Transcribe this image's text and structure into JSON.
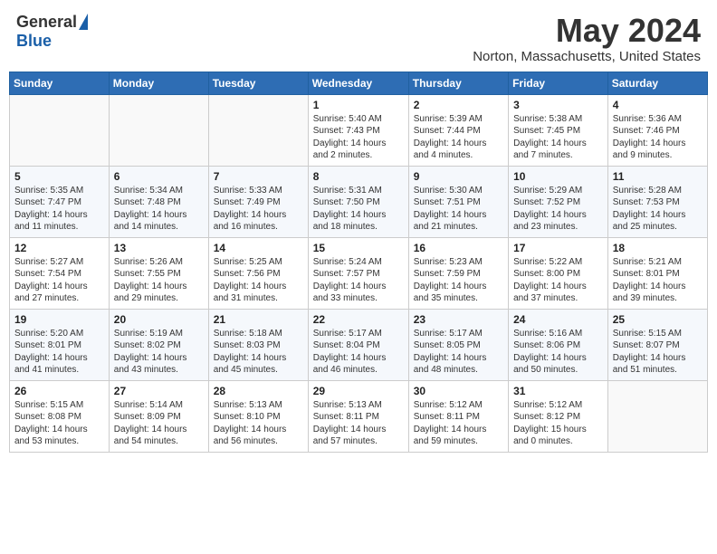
{
  "header": {
    "logo_general": "General",
    "logo_blue": "Blue",
    "month_year": "May 2024",
    "location": "Norton, Massachusetts, United States"
  },
  "calendar": {
    "days_of_week": [
      "Sunday",
      "Monday",
      "Tuesday",
      "Wednesday",
      "Thursday",
      "Friday",
      "Saturday"
    ],
    "weeks": [
      [
        {
          "day": "",
          "content": ""
        },
        {
          "day": "",
          "content": ""
        },
        {
          "day": "",
          "content": ""
        },
        {
          "day": "1",
          "content": "Sunrise: 5:40 AM\nSunset: 7:43 PM\nDaylight: 14 hours\nand 2 minutes."
        },
        {
          "day": "2",
          "content": "Sunrise: 5:39 AM\nSunset: 7:44 PM\nDaylight: 14 hours\nand 4 minutes."
        },
        {
          "day": "3",
          "content": "Sunrise: 5:38 AM\nSunset: 7:45 PM\nDaylight: 14 hours\nand 7 minutes."
        },
        {
          "day": "4",
          "content": "Sunrise: 5:36 AM\nSunset: 7:46 PM\nDaylight: 14 hours\nand 9 minutes."
        }
      ],
      [
        {
          "day": "5",
          "content": "Sunrise: 5:35 AM\nSunset: 7:47 PM\nDaylight: 14 hours\nand 11 minutes."
        },
        {
          "day": "6",
          "content": "Sunrise: 5:34 AM\nSunset: 7:48 PM\nDaylight: 14 hours\nand 14 minutes."
        },
        {
          "day": "7",
          "content": "Sunrise: 5:33 AM\nSunset: 7:49 PM\nDaylight: 14 hours\nand 16 minutes."
        },
        {
          "day": "8",
          "content": "Sunrise: 5:31 AM\nSunset: 7:50 PM\nDaylight: 14 hours\nand 18 minutes."
        },
        {
          "day": "9",
          "content": "Sunrise: 5:30 AM\nSunset: 7:51 PM\nDaylight: 14 hours\nand 21 minutes."
        },
        {
          "day": "10",
          "content": "Sunrise: 5:29 AM\nSunset: 7:52 PM\nDaylight: 14 hours\nand 23 minutes."
        },
        {
          "day": "11",
          "content": "Sunrise: 5:28 AM\nSunset: 7:53 PM\nDaylight: 14 hours\nand 25 minutes."
        }
      ],
      [
        {
          "day": "12",
          "content": "Sunrise: 5:27 AM\nSunset: 7:54 PM\nDaylight: 14 hours\nand 27 minutes."
        },
        {
          "day": "13",
          "content": "Sunrise: 5:26 AM\nSunset: 7:55 PM\nDaylight: 14 hours\nand 29 minutes."
        },
        {
          "day": "14",
          "content": "Sunrise: 5:25 AM\nSunset: 7:56 PM\nDaylight: 14 hours\nand 31 minutes."
        },
        {
          "day": "15",
          "content": "Sunrise: 5:24 AM\nSunset: 7:57 PM\nDaylight: 14 hours\nand 33 minutes."
        },
        {
          "day": "16",
          "content": "Sunrise: 5:23 AM\nSunset: 7:59 PM\nDaylight: 14 hours\nand 35 minutes."
        },
        {
          "day": "17",
          "content": "Sunrise: 5:22 AM\nSunset: 8:00 PM\nDaylight: 14 hours\nand 37 minutes."
        },
        {
          "day": "18",
          "content": "Sunrise: 5:21 AM\nSunset: 8:01 PM\nDaylight: 14 hours\nand 39 minutes."
        }
      ],
      [
        {
          "day": "19",
          "content": "Sunrise: 5:20 AM\nSunset: 8:01 PM\nDaylight: 14 hours\nand 41 minutes."
        },
        {
          "day": "20",
          "content": "Sunrise: 5:19 AM\nSunset: 8:02 PM\nDaylight: 14 hours\nand 43 minutes."
        },
        {
          "day": "21",
          "content": "Sunrise: 5:18 AM\nSunset: 8:03 PM\nDaylight: 14 hours\nand 45 minutes."
        },
        {
          "day": "22",
          "content": "Sunrise: 5:17 AM\nSunset: 8:04 PM\nDaylight: 14 hours\nand 46 minutes."
        },
        {
          "day": "23",
          "content": "Sunrise: 5:17 AM\nSunset: 8:05 PM\nDaylight: 14 hours\nand 48 minutes."
        },
        {
          "day": "24",
          "content": "Sunrise: 5:16 AM\nSunset: 8:06 PM\nDaylight: 14 hours\nand 50 minutes."
        },
        {
          "day": "25",
          "content": "Sunrise: 5:15 AM\nSunset: 8:07 PM\nDaylight: 14 hours\nand 51 minutes."
        }
      ],
      [
        {
          "day": "26",
          "content": "Sunrise: 5:15 AM\nSunset: 8:08 PM\nDaylight: 14 hours\nand 53 minutes."
        },
        {
          "day": "27",
          "content": "Sunrise: 5:14 AM\nSunset: 8:09 PM\nDaylight: 14 hours\nand 54 minutes."
        },
        {
          "day": "28",
          "content": "Sunrise: 5:13 AM\nSunset: 8:10 PM\nDaylight: 14 hours\nand 56 minutes."
        },
        {
          "day": "29",
          "content": "Sunrise: 5:13 AM\nSunset: 8:11 PM\nDaylight: 14 hours\nand 57 minutes."
        },
        {
          "day": "30",
          "content": "Sunrise: 5:12 AM\nSunset: 8:11 PM\nDaylight: 14 hours\nand 59 minutes."
        },
        {
          "day": "31",
          "content": "Sunrise: 5:12 AM\nSunset: 8:12 PM\nDaylight: 15 hours\nand 0 minutes."
        },
        {
          "day": "",
          "content": ""
        }
      ]
    ]
  }
}
